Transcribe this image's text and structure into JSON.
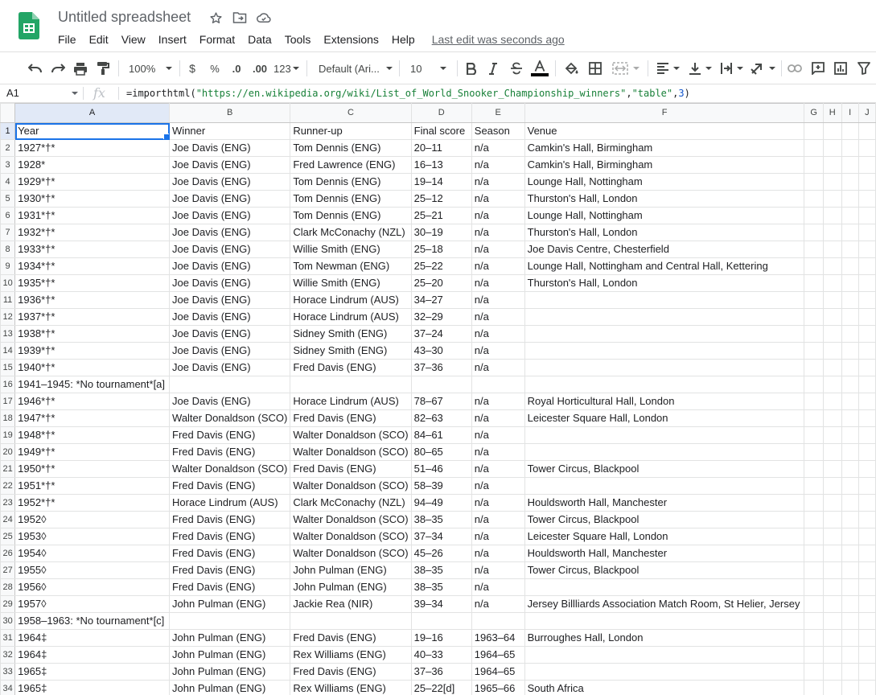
{
  "app": {
    "title": "Untitled spreadsheet",
    "last_edit": "Last edit was seconds ago",
    "menu": [
      "File",
      "Edit",
      "View",
      "Insert",
      "Format",
      "Data",
      "Tools",
      "Extensions",
      "Help"
    ]
  },
  "toolbar": {
    "zoom": "100%",
    "currency": "$",
    "percent": "%",
    "decrease_decimal": ".0",
    "increase_decimal": ".00",
    "more_formats": "123",
    "font": "Default (Ari...",
    "font_size": "10"
  },
  "formula_bar": {
    "name_box": "A1",
    "fx": "fx",
    "formula_prefix": "=importhtml(",
    "formula_url": "\"https://en.wikipedia.org/wiki/List_of_World_Snooker_Championship_winners\"",
    "formula_comma1": ",",
    "formula_type": "\"table\"",
    "formula_comma2": ",",
    "formula_index": "3",
    "formula_suffix": ")"
  },
  "grid": {
    "columns": [
      "A",
      "B",
      "C",
      "D",
      "E",
      "F",
      "G",
      "H",
      "I",
      "J"
    ],
    "selected_cell": "A1",
    "rows": [
      [
        "Year",
        "Winner",
        "Runner-up",
        "Final score",
        "Season",
        "Venue"
      ],
      [
        "1927*†*",
        "Joe Davis (ENG)",
        "Tom Dennis (ENG)",
        "20–11",
        "n/a",
        "Camkin's Hall, Birmingham"
      ],
      [
        "1928*",
        "Joe Davis (ENG)",
        "Fred Lawrence (ENG)",
        "16–13",
        "n/a",
        "Camkin's Hall, Birmingham"
      ],
      [
        "1929*†*",
        "Joe Davis (ENG)",
        "Tom Dennis (ENG)",
        "19–14",
        "n/a",
        "Lounge Hall, Nottingham"
      ],
      [
        "1930*†*",
        "Joe Davis (ENG)",
        "Tom Dennis (ENG)",
        "25–12",
        "n/a",
        "Thurston's Hall, London"
      ],
      [
        "1931*†*",
        "Joe Davis (ENG)",
        "Tom Dennis (ENG)",
        "25–21",
        "n/a",
        "Lounge Hall, Nottingham"
      ],
      [
        "1932*†*",
        "Joe Davis (ENG)",
        "Clark McConachy (NZL)",
        "30–19",
        "n/a",
        "Thurston's Hall, London"
      ],
      [
        "1933*†*",
        "Joe Davis (ENG)",
        "Willie Smith (ENG)",
        "25–18",
        "n/a",
        "Joe Davis Centre, Chesterfield"
      ],
      [
        "1934*†*",
        "Joe Davis (ENG)",
        "Tom Newman (ENG)",
        "25–22",
        "n/a",
        "Lounge Hall, Nottingham and Central Hall, Kettering"
      ],
      [
        "1935*†*",
        "Joe Davis (ENG)",
        "Willie Smith (ENG)",
        "25–20",
        "n/a",
        "Thurston's Hall, London"
      ],
      [
        "1936*†*",
        "Joe Davis (ENG)",
        "Horace Lindrum (AUS)",
        "34–27",
        "n/a",
        ""
      ],
      [
        "1937*†*",
        "Joe Davis (ENG)",
        "Horace Lindrum (AUS)",
        "32–29",
        "n/a",
        ""
      ],
      [
        "1938*†*",
        "Joe Davis (ENG)",
        "Sidney Smith (ENG)",
        "37–24",
        "n/a",
        ""
      ],
      [
        "1939*†*",
        "Joe Davis (ENG)",
        "Sidney Smith (ENG)",
        "43–30",
        "n/a",
        ""
      ],
      [
        "1940*†*",
        "Joe Davis (ENG)",
        "Fred Davis (ENG)",
        "37–36",
        "n/a",
        ""
      ],
      [
        "1941–1945: *No tournament*[a]",
        "",
        "",
        "",
        "",
        ""
      ],
      [
        "1946*†*",
        "Joe Davis (ENG)",
        "Horace Lindrum (AUS)",
        "78–67",
        "n/a",
        "Royal Horticultural Hall, London"
      ],
      [
        "1947*†*",
        "Walter Donaldson (SCO)",
        "Fred Davis (ENG)",
        "82–63",
        "n/a",
        "Leicester Square Hall, London"
      ],
      [
        "1948*†*",
        "Fred Davis (ENG)",
        "Walter Donaldson (SCO)",
        "84–61",
        "n/a",
        ""
      ],
      [
        "1949*†*",
        "Fred Davis (ENG)",
        "Walter Donaldson (SCO)",
        "80–65",
        "n/a",
        ""
      ],
      [
        "1950*†*",
        "Walter Donaldson (SCO)",
        "Fred Davis (ENG)",
        "51–46",
        "n/a",
        "Tower Circus, Blackpool"
      ],
      [
        "1951*†*",
        "Fred Davis (ENG)",
        "Walter Donaldson (SCO)",
        "58–39",
        "n/a",
        ""
      ],
      [
        "1952*†*",
        "Horace Lindrum (AUS)",
        "Clark McConachy (NZL)",
        "94–49",
        "n/a",
        "Houldsworth Hall, Manchester"
      ],
      [
        "1952◊",
        "Fred Davis (ENG)",
        "Walter Donaldson (SCO)",
        "38–35",
        "n/a",
        "Tower Circus, Blackpool"
      ],
      [
        "1953◊",
        "Fred Davis (ENG)",
        "Walter Donaldson (SCO)",
        "37–34",
        "n/a",
        "Leicester Square Hall, London"
      ],
      [
        "1954◊",
        "Fred Davis (ENG)",
        "Walter Donaldson (SCO)",
        "45–26",
        "n/a",
        "Houldsworth Hall, Manchester"
      ],
      [
        "1955◊",
        "Fred Davis (ENG)",
        "John Pulman (ENG)",
        "38–35",
        "n/a",
        "Tower Circus, Blackpool"
      ],
      [
        "1956◊",
        "Fred Davis (ENG)",
        "John Pulman (ENG)",
        "38–35",
        "n/a",
        ""
      ],
      [
        "1957◊",
        "John Pulman (ENG)",
        "Jackie Rea (NIR)",
        "39–34",
        "n/a",
        "Jersey Billliards Association Match Room, St Helier, Jersey"
      ],
      [
        "1958–1963: *No tournament*[c]",
        "",
        "",
        "",
        "",
        ""
      ],
      [
        "1964‡",
        "John Pulman (ENG)",
        "Fred Davis (ENG)",
        "19–16",
        "1963–64",
        "Burroughes Hall, London"
      ],
      [
        "1964‡",
        "John Pulman (ENG)",
        "Rex Williams (ENG)",
        "40–33",
        "1964–65",
        ""
      ],
      [
        "1965‡",
        "John Pulman (ENG)",
        "Fred Davis (ENG)",
        "37–36",
        "1964–65",
        ""
      ],
      [
        "1965‡",
        "John Pulman (ENG)",
        "Rex Williams (ENG)",
        "25–22[d]",
        "1965–66",
        "South Africa"
      ]
    ]
  }
}
